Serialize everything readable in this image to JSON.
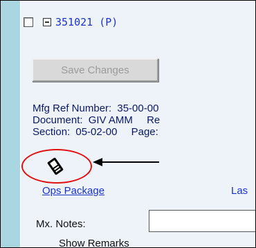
{
  "header": {
    "record_label": "351021 (P)"
  },
  "toolbar": {
    "save_label": "Save Changes"
  },
  "info": {
    "mfg_ref_label": "Mfg Ref Number:",
    "mfg_ref_value": "35-00-00",
    "document_label": "Document:",
    "document_value": "GIV AMM",
    "rev_label": "Re",
    "section_label": "Section:",
    "section_value": "05-02-00",
    "page_label": "Page:"
  },
  "icons": {
    "attachment": "paperclip-icon",
    "annotation_circle_color": "#e01010"
  },
  "links": {
    "ops_package": "Ops Package",
    "last": "Las"
  },
  "notes": {
    "label": "Mx. Notes:",
    "value": ""
  },
  "remarks": {
    "label": "Show Remarks"
  }
}
